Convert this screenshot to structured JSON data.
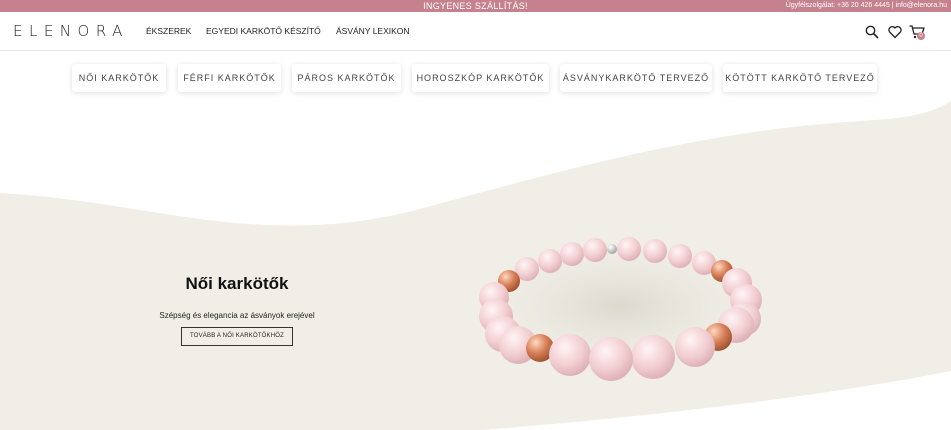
{
  "topbar": {
    "promo": "INGYENES SZÁLLÍTÁS!",
    "contact": "Ügyfélszolgálat: +36 20 426 4445 | info@elenora.hu",
    "background": "#c6818e"
  },
  "header": {
    "logo": "ELENORA",
    "nav": [
      "ÉKSZEREK",
      "EGYEDI KARKÖTŐ KÉSZÍTŐ",
      "ÁSVÁNY LEXIKON"
    ],
    "icons": [
      "search-icon",
      "heart-icon",
      "cart-icon"
    ],
    "cart_count": "0"
  },
  "categories": [
    "NŐI KARKÖTŐK",
    "FÉRFI KARKÖTŐK",
    "PÁROS KARKÖTŐK",
    "HOROSZKÓP KARKÖTŐK",
    "ÁSVÁNYKARKÖTŐ TERVEZŐ",
    "KÖTÖTT KARKÖTŐ TERVEZŐ"
  ],
  "hero": {
    "title": "Női karkötők",
    "subtitle": "Szépség és elegancia az ásványok erejével",
    "button": "TOVÁBB A NŐI KARKÖTŐKHÖZ",
    "background": "#f0eee6",
    "bead_color": "#f2cfd3",
    "accent_bead_color": "#d9825b"
  }
}
